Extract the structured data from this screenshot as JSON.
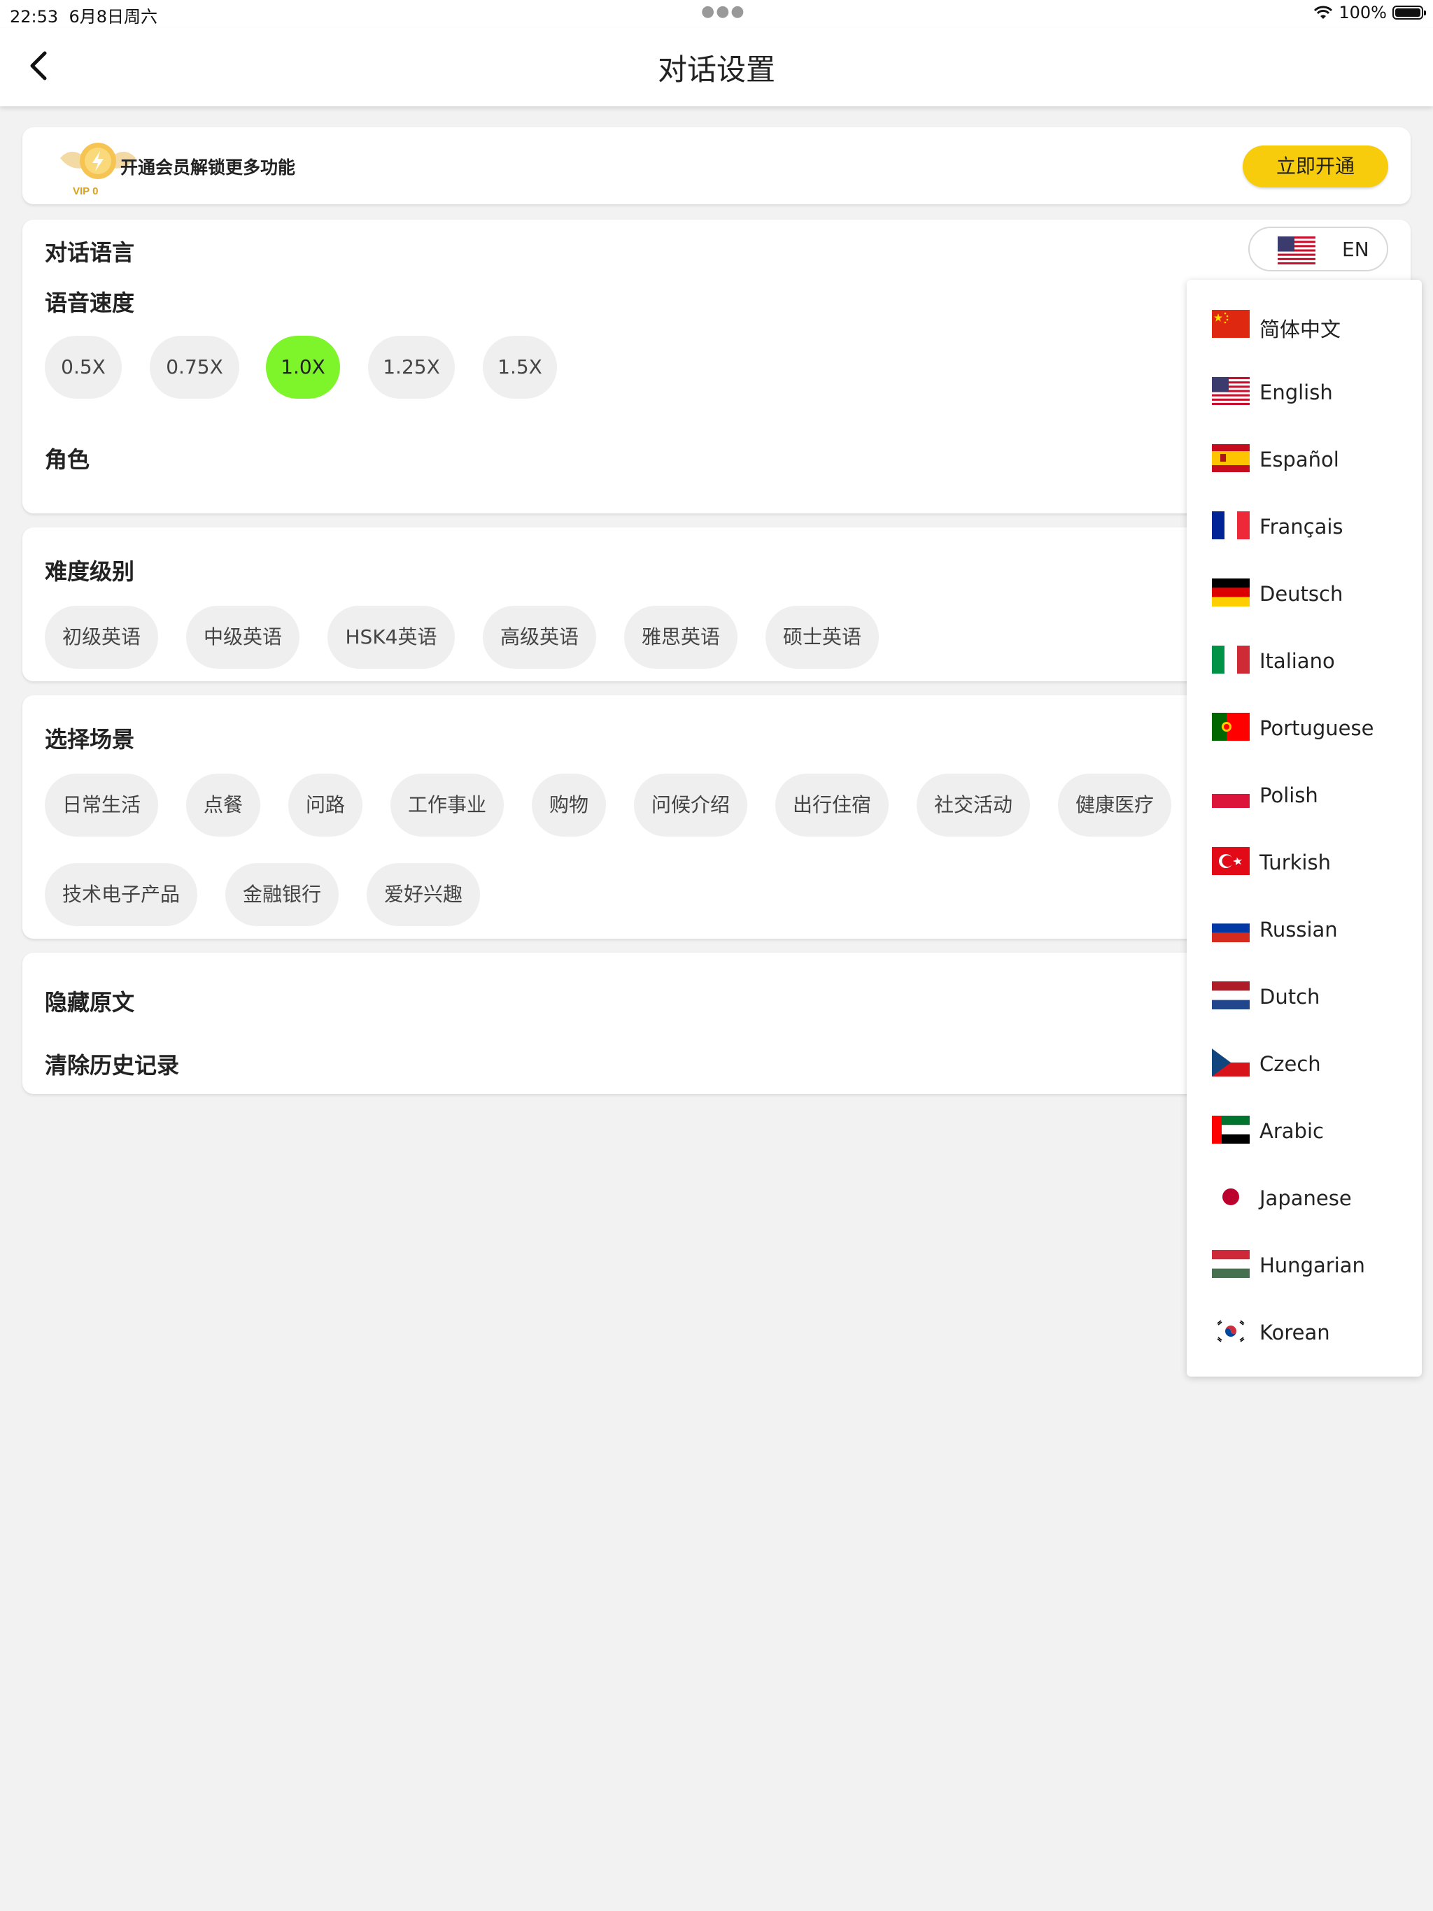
{
  "status_bar": {
    "time": "22:53",
    "date": "6月8日周六",
    "battery": "100%"
  },
  "nav": {
    "title": "对话设置"
  },
  "vip": {
    "badge_text": "VIP 0",
    "message": "开通会员解锁更多功能",
    "button": "立即开通"
  },
  "language": {
    "title": "对话语言",
    "selected_code": "EN"
  },
  "speed": {
    "title": "语音速度",
    "options": [
      "0.5X",
      "0.75X",
      "1.0X",
      "1.25X",
      "1.5X"
    ],
    "selected": "1.0X"
  },
  "role": {
    "title": "角色"
  },
  "difficulty": {
    "title": "难度级别",
    "options": [
      "初级英语",
      "中级英语",
      "HSK4英语",
      "高级英语",
      "雅思英语",
      "硕士英语"
    ]
  },
  "scene": {
    "title": "选择场景",
    "options": [
      "日常生活",
      "点餐",
      "问路",
      "工作事业",
      "购物",
      "问候介绍",
      "出行住宿",
      "社交活动",
      "健康医疗",
      "技术电子产品",
      "金融银行",
      "爱好兴趣"
    ]
  },
  "misc": {
    "hide_original": "隐藏原文",
    "clear_history": "清除历史记录"
  },
  "dropdown": {
    "languages": [
      {
        "label": "简体中文",
        "flag": "china-flag"
      },
      {
        "label": "English",
        "flag": "us-flag"
      },
      {
        "label": "Español",
        "flag": "spain-flag"
      },
      {
        "label": "Français",
        "flag": "france-flag"
      },
      {
        "label": "Deutsch",
        "flag": "germany-flag"
      },
      {
        "label": "Italiano",
        "flag": "italy-flag"
      },
      {
        "label": "Portuguese",
        "flag": "portugal-flag"
      },
      {
        "label": "Polish",
        "flag": "poland-flag"
      },
      {
        "label": "Turkish",
        "flag": "turkey-flag"
      },
      {
        "label": "Russian",
        "flag": "russia-flag"
      },
      {
        "label": "Dutch",
        "flag": "netherlands-flag"
      },
      {
        "label": "Czech",
        "flag": "czech-flag"
      },
      {
        "label": "Arabic",
        "flag": "uae-flag"
      },
      {
        "label": "Japanese",
        "flag": "japan-flag"
      },
      {
        "label": "Hungarian",
        "flag": "hungary-flag"
      },
      {
        "label": "Korean",
        "flag": "korea-flag"
      }
    ]
  },
  "colors": {
    "accent_yellow": "#f7cc0c",
    "selected_green": "#7df52a",
    "background": "#f2f2f2"
  }
}
